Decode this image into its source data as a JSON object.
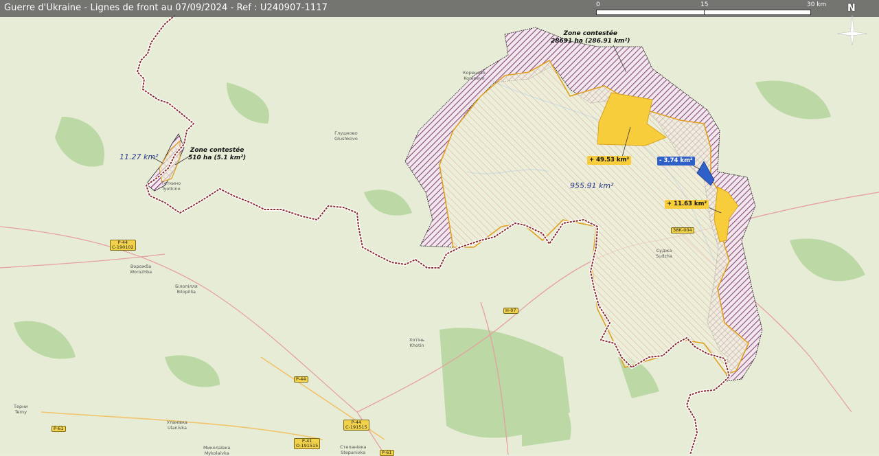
{
  "title": "Guerre d'Ukraine - Lignes de front au 07/09/2024 - Ref : U240907-1117",
  "scale": {
    "tick_0": "0",
    "tick_mid": "15",
    "tick_end": "30 km"
  },
  "north_label": "N",
  "annotations": {
    "zone_contested_large": {
      "line1": "Zone contestée",
      "line2": "28691 ha (286.91 km²)"
    },
    "zone_contested_small": {
      "line1": "Zone contestée",
      "line2": "510 ha (5.1 km²)"
    },
    "area_small": "11.27 km²",
    "area_main": "955.91 km²",
    "gain_north": "+ 49.53 km²",
    "loss_blue": "- 3.74 km²",
    "gain_east": "+ 11.63 km²"
  },
  "roads": [
    "Р-44\nС-190102",
    "Н-07",
    "Р-44",
    "Р-44\nС-191515",
    "Р-61",
    "Р-41\nО-191515",
    "Р-61",
    "38К-004"
  ],
  "towns": [
    "Коренево\nKorenevo",
    "Глушково\nGlushkovo",
    "Теткино\nTyotkino",
    "Ворожба\nWorozhba",
    "Білопілля\nBilopillia",
    "Суджа\nSudzha",
    "Хотінь\nKhotin",
    "Уланівка\nUlanivka",
    "Миколаївка\nMykolaivka",
    "Терни\nTerny",
    "Степанівка\nStepanivka"
  ],
  "colors": {
    "frontline": "#8b2b2b",
    "contested_hatch": "#7a2d6b",
    "held_area_outline": "#e0a020",
    "gain": "#f7cd3c",
    "loss": "#2f5fc8",
    "title_bg": "#5a5a5a"
  }
}
